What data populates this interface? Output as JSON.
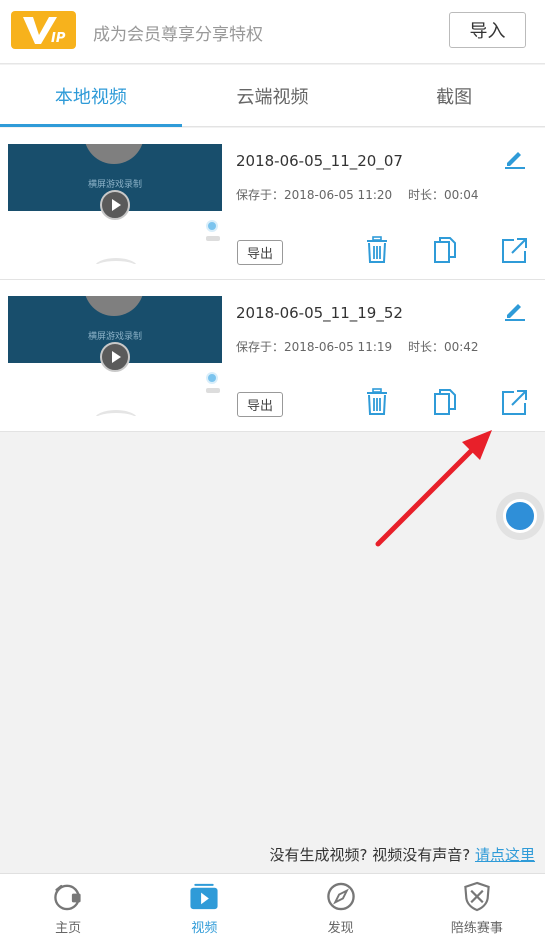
{
  "header": {
    "vip_badge_text": "VIP",
    "vip_slogan": "成为会员尊享分享特权",
    "import_label": "导入"
  },
  "tabs": [
    {
      "label": "本地视频",
      "active": true
    },
    {
      "label": "云端视频",
      "active": false
    },
    {
      "label": "截图",
      "active": false
    }
  ],
  "videos": [
    {
      "title": "2018-06-05_11_20_07",
      "saved_label": "保存于：2018-06-05 11:20",
      "duration_label": "时长：00:04",
      "thumb_caption": "横屏游戏录制",
      "export_label": "导出"
    },
    {
      "title": "2018-06-05_11_19_52",
      "saved_label": "保存于：2018-06-05 11:19",
      "duration_label": "时长：00:42",
      "thumb_caption": "横屏游戏录制",
      "export_label": "导出"
    }
  ],
  "help": {
    "text": "没有生成视频? 视频没有声音? ",
    "link": "请点这里"
  },
  "bottom_nav": [
    {
      "label": "主页",
      "icon": "camera-home-icon",
      "active": false
    },
    {
      "label": "视频",
      "icon": "video-play-icon",
      "active": true
    },
    {
      "label": "发现",
      "icon": "compass-icon",
      "active": false
    },
    {
      "label": "陪练赛事",
      "icon": "swords-shield-icon",
      "active": false
    }
  ],
  "colors": {
    "accent": "#2f9bd8",
    "vip": "#f7b21c",
    "thumb": "#184e6c",
    "arrow": "#e8202a"
  }
}
